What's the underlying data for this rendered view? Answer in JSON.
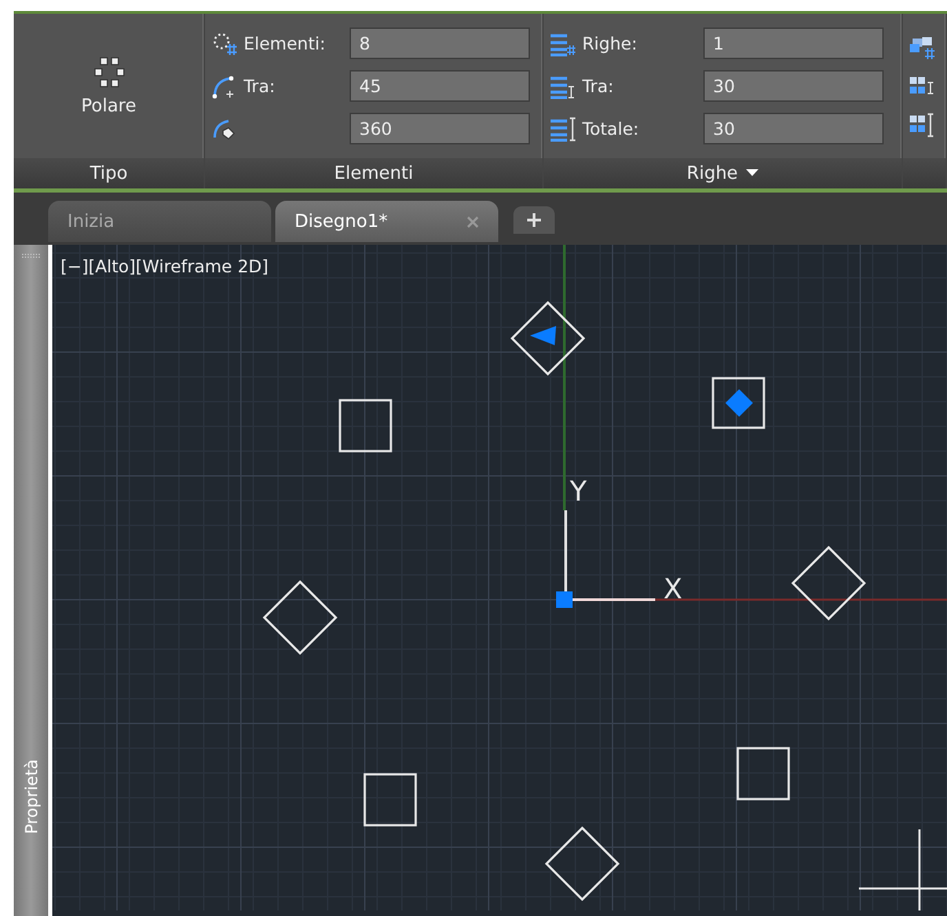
{
  "ribbon": {
    "panels": [
      {
        "kind": "type",
        "title": "Tipo",
        "button": {
          "label": "Polare"
        }
      },
      {
        "kind": "fields",
        "title": "Elementi",
        "has_menu": false,
        "rows": [
          {
            "label": "Elementi:",
            "value": "8"
          },
          {
            "label": "Tra:",
            "value": "45"
          },
          {
            "value": "360"
          }
        ]
      },
      {
        "kind": "fields",
        "title": "Righe",
        "has_menu": true,
        "rows": [
          {
            "label": "Righe:",
            "value": "1"
          },
          {
            "label": "Tra:",
            "value": "30"
          },
          {
            "label": "Totale:",
            "value": "30"
          }
        ]
      },
      {
        "kind": "icons"
      }
    ]
  },
  "tabs": [
    {
      "label": "Inizia",
      "selected": false,
      "closable": false
    },
    {
      "label": "Disegno1*",
      "selected": true,
      "closable": true
    }
  ],
  "side_panel": {
    "label": "Proprietà"
  },
  "viewport": {
    "label": "[−][Alto][Wireframe 2D]",
    "axis_y": "Y",
    "axis_x": "X"
  }
}
